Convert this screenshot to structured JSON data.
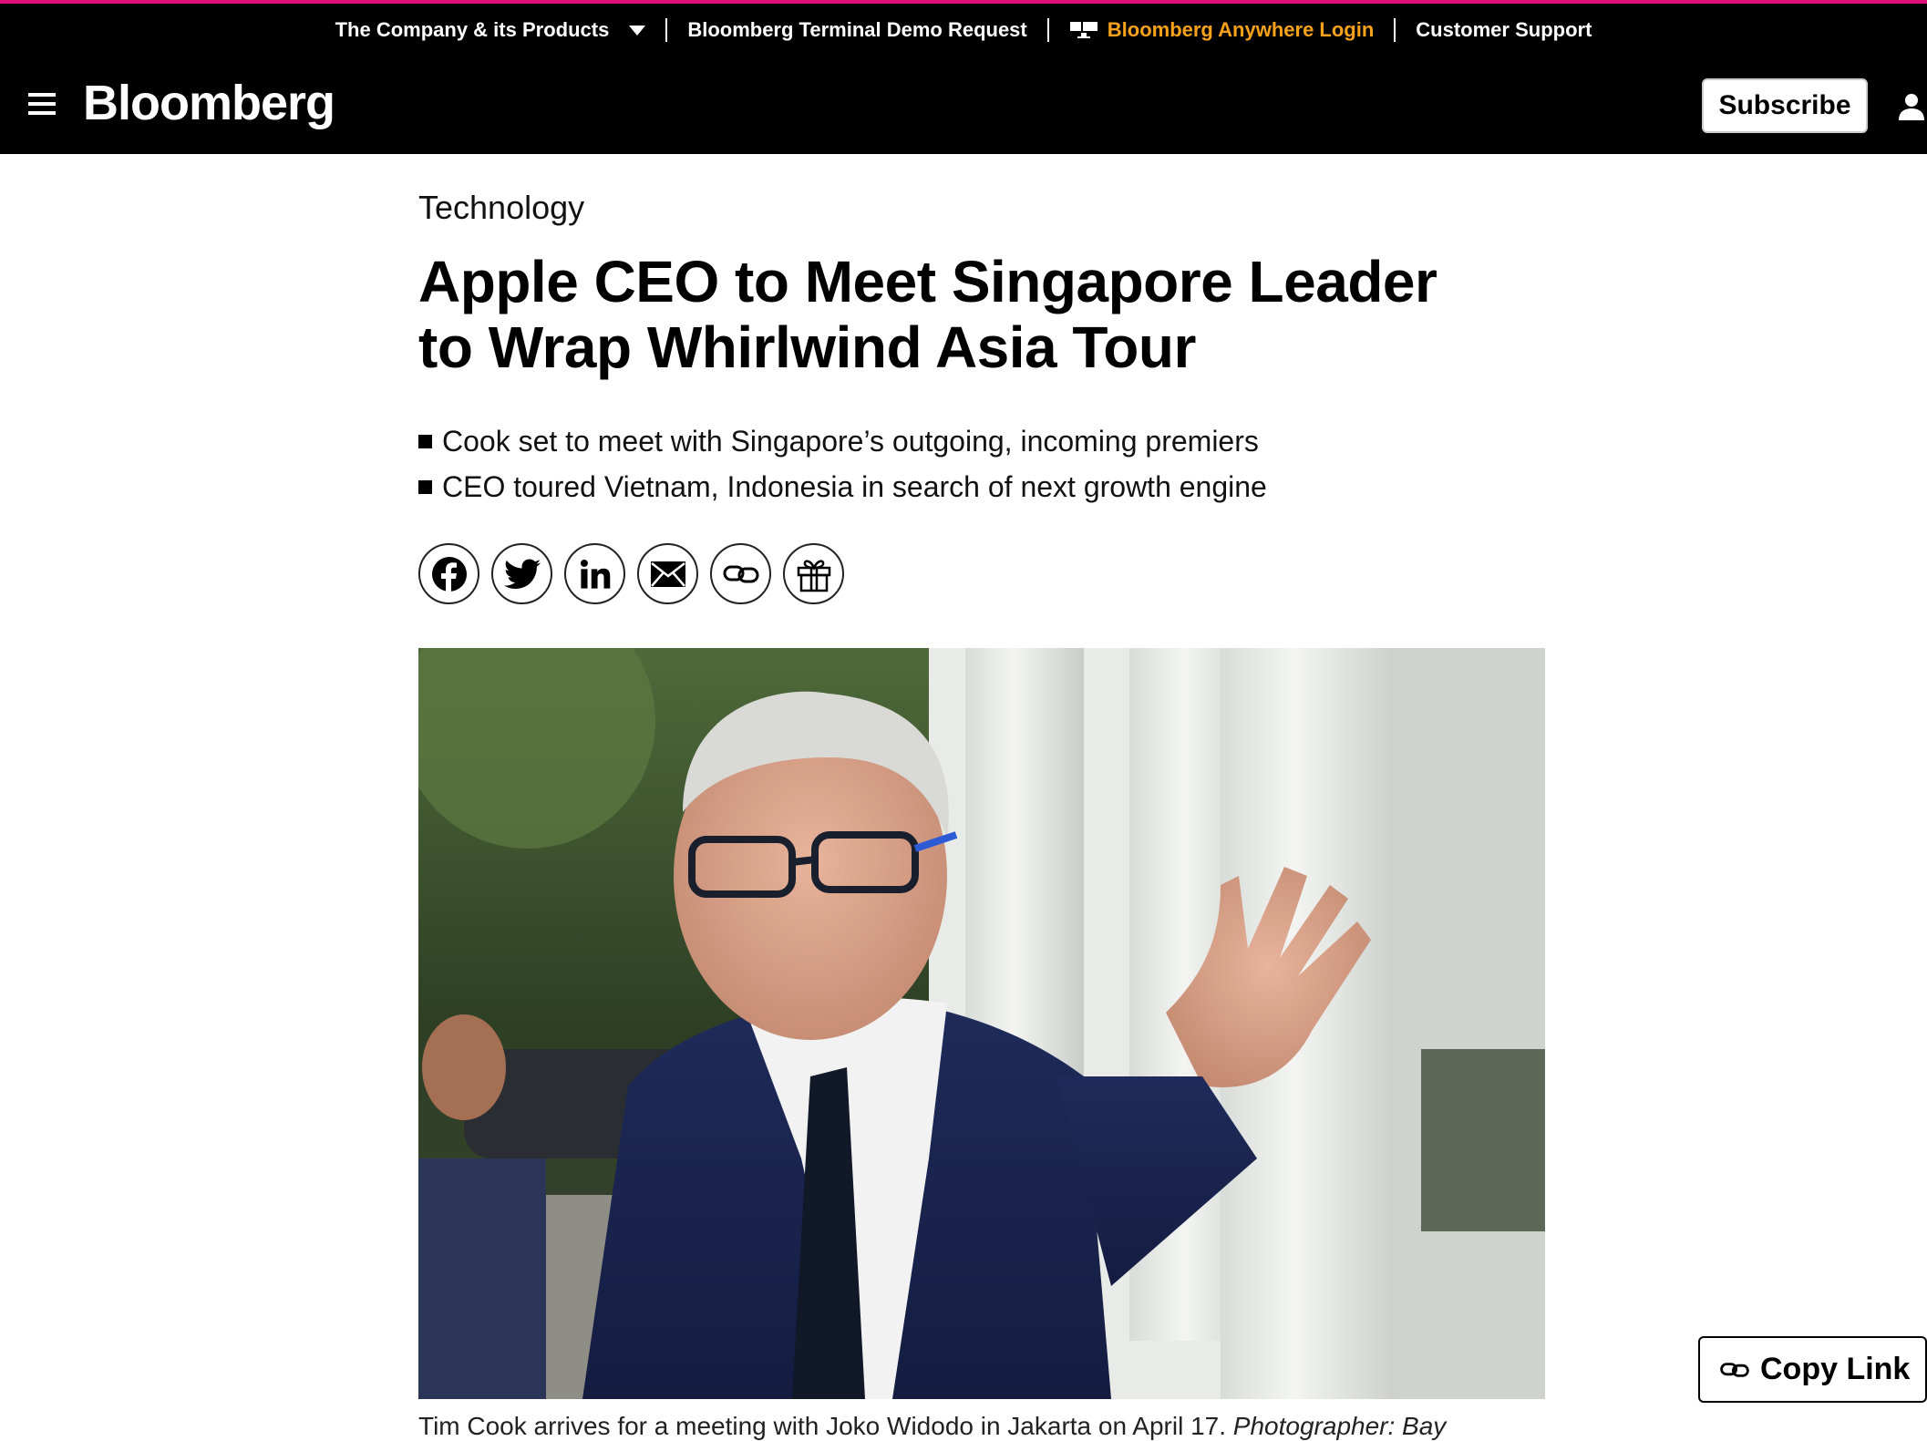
{
  "utility_bar": {
    "company": "The Company & its Products",
    "terminal_demo": "Bloomberg Terminal Demo Request",
    "anywhere_login": "Bloomberg Anywhere Login",
    "support": "Customer Support",
    "accent_color": "#f7a21b",
    "top_line_color": "#e0107a"
  },
  "nav": {
    "logo": "Bloomberg",
    "subscribe": "Subscribe"
  },
  "article": {
    "section": "Technology",
    "headline_line1": "Apple CEO to Meet Singapore Leader",
    "headline_line2": "to Wrap Whirlwind Asia Tour",
    "bullets": [
      "Cook set to meet with Singapore’s outgoing, incoming premiers",
      "CEO toured Vietnam, Indonesia in search of next growth engine"
    ],
    "share_icons": [
      "facebook-icon",
      "twitter-icon",
      "linkedin-icon",
      "email-icon",
      "link-icon",
      "gift-icon"
    ],
    "caption_text": "Tim Cook arrives for a meeting with Joko Widodo in Jakarta on April 17. ",
    "caption_credit": "Photographer: Bay"
  },
  "copy_link": {
    "label": "Copy Link"
  }
}
